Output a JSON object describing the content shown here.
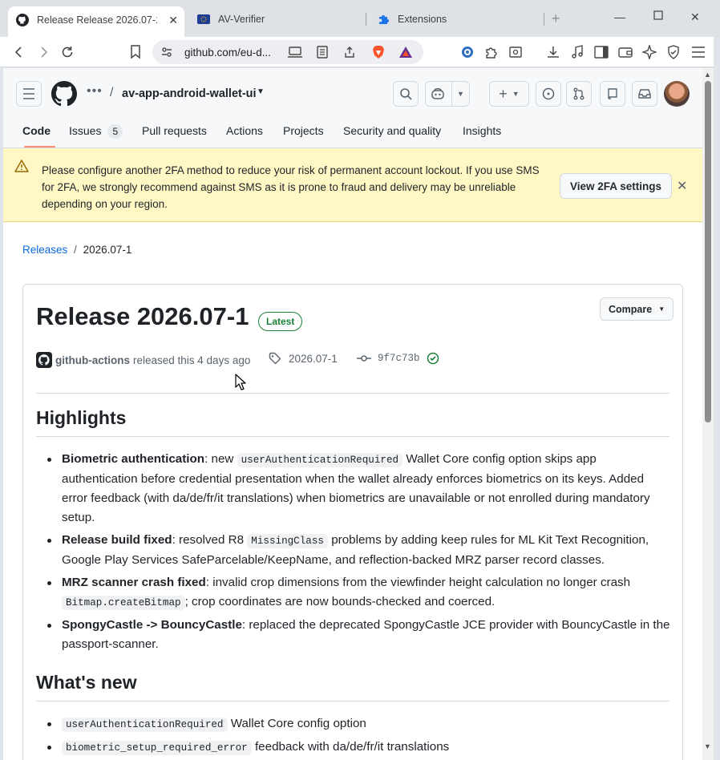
{
  "browser": {
    "tabs": [
      {
        "title": "Release Release 2026.07-1 ·",
        "active": true
      },
      {
        "title": "AV-Verifier",
        "active": false
      },
      {
        "title": "Extensions",
        "active": false
      }
    ],
    "url": "github.com/eu-d..."
  },
  "github": {
    "repo": "av-app-android-wallet-ui",
    "nav": {
      "code": "Code",
      "issues": "Issues",
      "issues_count": "5",
      "pulls": "Pull requests",
      "actions": "Actions",
      "projects": "Projects",
      "security": "Security and quality",
      "insights": "Insights"
    },
    "flash": {
      "message": "Please configure another 2FA method to reduce your risk of permanent account lockout. If you use SMS for 2FA, we strongly recommend against SMS as it is prone to fraud and delivery may be unreliable depending on your region.",
      "button": "View 2FA settings"
    },
    "breadcrumb": {
      "root": "Releases",
      "separator": "/",
      "current": "2026.07-1"
    }
  },
  "release": {
    "title": "Release 2026.07-1",
    "badge": "Latest",
    "compare": "Compare",
    "author": "github-actions",
    "released_text": "released this 4 days ago",
    "tag": "2026.07-1",
    "commit": "9f7c73b",
    "highlights_heading": "Highlights",
    "highlights": [
      {
        "label": "Biometric authentication",
        "t1": ": new ",
        "code": "userAuthenticationRequired",
        "t2": " Wallet Core config option skips app authentication before credential presentation when the wallet already enforces biometrics on its keys. Added error feedback (with da/de/fr/it translations) when biometrics are unavailable or not enrolled during mandatory setup."
      },
      {
        "label": "Release build fixed",
        "t1": ": resolved R8 ",
        "code": "MissingClass",
        "t2": " problems by adding keep rules for ML Kit Text Recognition, Google Play Services SafeParcelable/KeepName, and reflection-backed MRZ parser record classes."
      },
      {
        "label": "MRZ scanner crash fixed",
        "t1": ": invalid crop dimensions from the viewfinder height calculation no longer crash ",
        "code": "Bitmap.createBitmap",
        "t2": "; crop coordinates are now bounds-checked and coerced."
      },
      {
        "label": "SpongyCastle -> BouncyCastle",
        "t1": ": replaced the deprecated SpongyCastle JCE provider with BouncyCastle in the passport-scanner.",
        "code": "",
        "t2": ""
      }
    ],
    "whatsnew_heading": "What's new",
    "whatsnew": [
      {
        "code": "userAuthenticationRequired",
        "text": " Wallet Core config option"
      },
      {
        "code": "biometric_setup_required_error",
        "text": " feedback with da/de/fr/it translations"
      }
    ]
  },
  "colors": {
    "accent": "#fd8c73",
    "link": "#0969da",
    "success": "#1a7f37",
    "flash_bg": "#fff8c5"
  }
}
